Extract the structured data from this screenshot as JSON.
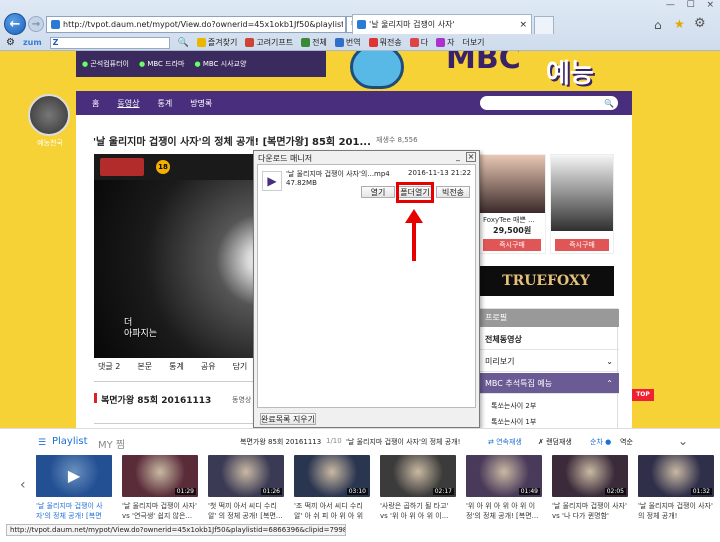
{
  "browser": {
    "url": "http://tvpot.daum.net/mypot/View.do?ownerid=45x1okb1Jf50&playlistid=686639(",
    "tab_label": "'날 울리지마 겁쟁이 사자'",
    "zum_label": "zum",
    "commands": [
      "즐겨찾기",
      "고려기프트",
      "전체",
      "번역",
      "뭐전송",
      "다",
      "자",
      "더보기"
    ]
  },
  "channel": {
    "header_links": [
      "곤석컴퓨터이",
      "MBC 드라마",
      "MBC 시사교양"
    ],
    "banner_text": "예능",
    "nav": [
      "홈",
      "동영상",
      "통계",
      "방명록"
    ],
    "avatar_caption": "예능천국",
    "title": "'날 울리지마 겁쟁이 사자'의 정체 공개! [복면가왕] 85회 201...",
    "views": "재생수 8,556",
    "video_caption_1": "더",
    "video_caption_2": "아파지는",
    "score_badge": "18",
    "tabs": [
      "댓글 2",
      "본문",
      "통계",
      "공유",
      "담기"
    ],
    "section_title": "복면가왕 85회 20161113",
    "section_count": "동영상 10"
  },
  "ads": {
    "card1_name": "FoxyTee 매쁜 ...",
    "card1_price": "29,500원",
    "buy_label": "즉시구매",
    "brand": "TRUEFOXY"
  },
  "sidebar": {
    "header": "프로필",
    "items": [
      "전체동영상",
      "미리보기",
      "MBC 추석특집 예능",
      "톡쏘는사이 2부",
      "톡쏘는사이 1부"
    ],
    "top_label": "TOP"
  },
  "dialog": {
    "title": "다운로드 매니저",
    "filename": "'날 울리지마 겁쟁이 사자'의...mp4",
    "datetime": "2016-11-13 21:22",
    "filesize": "47.82MB",
    "btn_open": "열기",
    "btn_folder": "폴더열기",
    "btn_resend": "빅전송",
    "btn_clear": "완료목록 지우기"
  },
  "playlist": {
    "tab_playlist": "Playlist",
    "tab_my": "MY 찜",
    "now_playing": "복면가왕 85회 20161113",
    "position": "1/10",
    "now_title": "'날 울리지마 겁쟁이 사자'의 정체 공개!",
    "autoplay": "연속재생",
    "shuffle": "랜덤재생",
    "order": "순차",
    "reverse": "역순",
    "items": [
      {
        "dur": "",
        "cap": "'날 울리지마 겁쟁이 사자'의 정체 공개! [복면가..."
      },
      {
        "dur": "01:29",
        "cap": "'날 울리지마 겁쟁이 사자' vs '연극생' 쉽지 않은..."
      },
      {
        "dur": "01:26",
        "cap": "'첫 떡끼 아서 씨디 수리 알' 의 정체 공개! [복면..."
      },
      {
        "dur": "03:10",
        "cap": "'조 떡끼 아서 씨디 수리 알' 아 쉬 피 아 위 아 위 이..."
      },
      {
        "dur": "02:17",
        "cap": "'사랑은 곱하기 될 타고' vs '위 아 위 아 위 이..."
      },
      {
        "dur": "01:49",
        "cap": "'위 아 위 아 위 아 위 이 정'의 정체 공개! [복면..."
      },
      {
        "dur": "02:05",
        "cap": "'날 울리지마 겁쟁이 사자' vs '나 다가 퀸명함'"
      },
      {
        "dur": "01:32",
        "cap": "'날 울리지마 겁쟁이 사자' 의 정체 공개!"
      }
    ]
  },
  "statusbar": "http://tvpot.daum.net/mypot/View.do?ownerid=45x1okb1Jf50&playlistid=6866396&clipid=79989649",
  "colors": {
    "purple": "#4a2e7e",
    "yellow": "#f7d237",
    "blue": "#1e6fd6",
    "red": "#e00"
  }
}
